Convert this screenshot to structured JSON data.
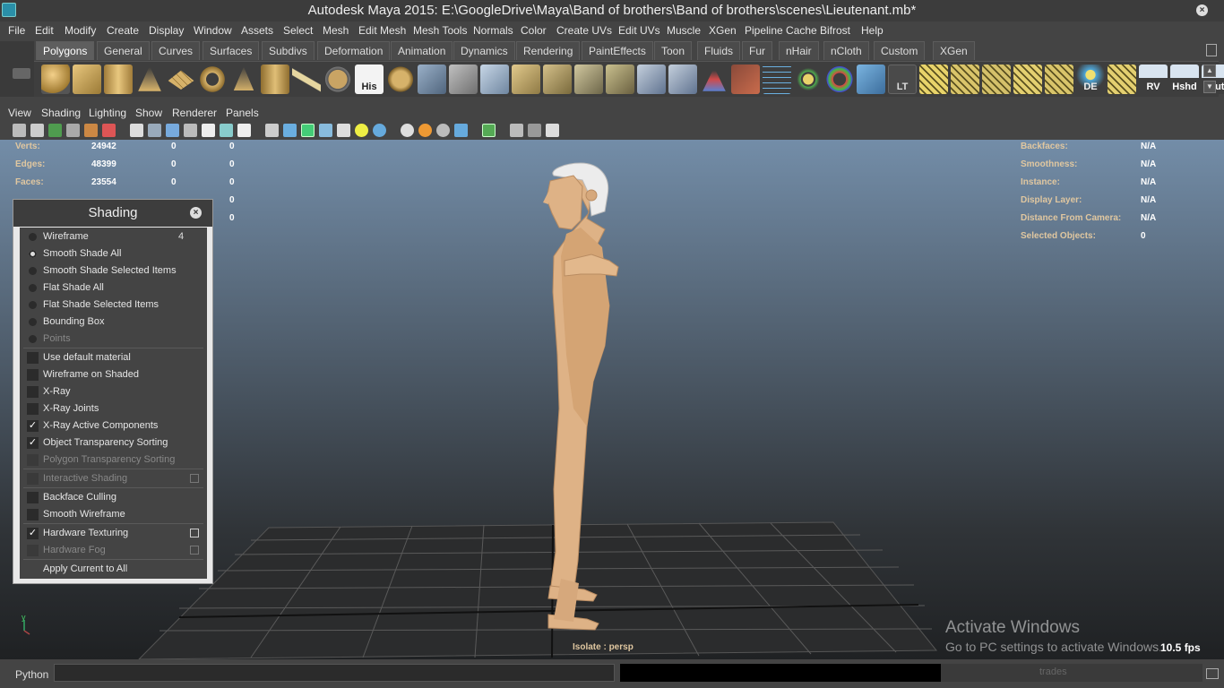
{
  "title": "Autodesk Maya 2015: E:\\GoogleDrive\\Maya\\Band of brothers\\Band of brothers\\scenes\\Lieutenant.mb*",
  "menu": [
    "File",
    "Edit",
    "Modify",
    "Create",
    "Display",
    "Window",
    "Assets",
    "Select",
    "Mesh",
    "Edit Mesh",
    "Mesh Tools",
    "Normals",
    "Color",
    "Create UVs",
    "Edit UVs",
    "Muscle",
    "XGen",
    "Pipeline Cache",
    "Bifrost",
    "Help"
  ],
  "shelf_tabs": [
    "Polygons",
    "General",
    "Curves",
    "Surfaces",
    "Subdivs",
    "Deformation",
    "Animation",
    "Dynamics",
    "Rendering",
    "PaintEffects",
    "Toon",
    "Fluids",
    "Fur",
    "nHair",
    "nCloth",
    "Custom",
    "XGen"
  ],
  "active_shelf_tab": "Polygons",
  "shelf_labels": {
    "his": "His",
    "lt": "LT",
    "de": "DE",
    "rv": "RV",
    "hshd": "Hshd",
    "out": "Out"
  },
  "panel_menu": [
    "View",
    "Shading",
    "Lighting",
    "Show",
    "Renderer",
    "Panels"
  ],
  "hud_left": {
    "rows": [
      {
        "label": "Verts:",
        "v1": "24942",
        "v2": "0",
        "v3": "0"
      },
      {
        "label": "Edges:",
        "v1": "48399",
        "v2": "0",
        "v3": "0"
      },
      {
        "label": "Faces:",
        "v1": "23554",
        "v2": "0",
        "v3": "0"
      }
    ],
    "extra": [
      "0",
      "0"
    ]
  },
  "hud_right": [
    {
      "label": "Backfaces:",
      "value": "N/A"
    },
    {
      "label": "Smoothness:",
      "value": "N/A"
    },
    {
      "label": "Instance:",
      "value": "N/A"
    },
    {
      "label": "Display Layer:",
      "value": "N/A"
    },
    {
      "label": "Distance From Camera:",
      "value": "N/A"
    },
    {
      "label": "Selected Objects:",
      "value": "0"
    }
  ],
  "shading_panel": {
    "title": "Shading",
    "hotkey": "4",
    "radios": [
      {
        "label": "Wireframe",
        "on": false,
        "dim": false
      },
      {
        "label": "Smooth Shade All",
        "on": true,
        "dim": false
      },
      {
        "label": "Smooth Shade Selected Items",
        "on": false,
        "dim": false
      },
      {
        "label": "Flat Shade All",
        "on": false,
        "dim": false
      },
      {
        "label": "Flat Shade Selected Items",
        "on": false,
        "dim": false
      },
      {
        "label": "Bounding Box",
        "on": false,
        "dim": false
      },
      {
        "label": "Points",
        "on": false,
        "dim": true
      }
    ],
    "checks": [
      {
        "label": "Use default material",
        "checked": false,
        "dim": false
      },
      {
        "label": "Wireframe on Shaded",
        "checked": false,
        "dim": false
      },
      {
        "label": "X-Ray",
        "checked": false,
        "dim": false
      },
      {
        "label": "X-Ray Joints",
        "checked": false,
        "dim": false
      },
      {
        "label": "X-Ray Active Components",
        "checked": true,
        "dim": false
      },
      {
        "label": "Object Transparency Sorting",
        "checked": true,
        "dim": false
      },
      {
        "label": "Polygon Transparency Sorting",
        "checked": false,
        "dim": true
      }
    ],
    "interactive": {
      "label": "Interactive Shading",
      "dim": true
    },
    "checks2": [
      {
        "label": "Backface Culling",
        "checked": false
      },
      {
        "label": "Smooth Wireframe",
        "checked": false
      }
    ],
    "hardware_texturing": {
      "label": "Hardware Texturing",
      "checked": true
    },
    "hardware_fog": {
      "label": "Hardware Fog",
      "dim": true
    },
    "apply": "Apply Current to All"
  },
  "viewport": {
    "isolate": "Isolate : persp",
    "fps": "10.5 fps",
    "axis_y": "y",
    "watermark_title": "Activate Windows",
    "watermark_sub": "Go to PC settings to activate Windows."
  },
  "status": {
    "python": "Python",
    "faded": "trades"
  },
  "colors": {
    "skin": "#e0b48a",
    "hair": "#ececec",
    "grid": "#555555"
  }
}
